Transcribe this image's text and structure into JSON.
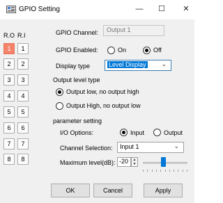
{
  "window": {
    "title": "GPIO Setting",
    "minimize": "—",
    "maximize": "☐",
    "close": "✕"
  },
  "channels": {
    "ro_header": "R.O",
    "ri_header": "R.I",
    "ro": [
      "1",
      "2",
      "3",
      "4",
      "5",
      "6",
      "7",
      "8"
    ],
    "ri": [
      "1",
      "2",
      "3",
      "4",
      "5",
      "6",
      "7",
      "8"
    ],
    "selected_ro": "1",
    "accent": "#f4836a"
  },
  "gpio_channel": {
    "label": "GPIO Channel:",
    "value": "Output 1"
  },
  "gpio_enabled": {
    "label": "GPIO Enabled:",
    "options": [
      "On",
      "Off"
    ],
    "selected": "Off"
  },
  "display_type": {
    "label": "Display type",
    "value": "Level Display"
  },
  "output_level": {
    "heading": "Output level type",
    "options": [
      "Output low, no output high",
      "Output High, no output low"
    ],
    "selected": "Output low, no output high"
  },
  "parameter": {
    "heading": "parameter setting",
    "io_options": {
      "label": "I/O Options:",
      "options": [
        "Input",
        "Output"
      ],
      "selected": "Input"
    },
    "channel_selection": {
      "label": "Channel Selection:",
      "value": "Input 1"
    },
    "max_level": {
      "label": "Maximum level(dB):",
      "value": "-20",
      "slider_fraction": 0.45
    }
  },
  "buttons": {
    "ok": "OK",
    "cancel": "Cancel",
    "apply": "Apply"
  }
}
